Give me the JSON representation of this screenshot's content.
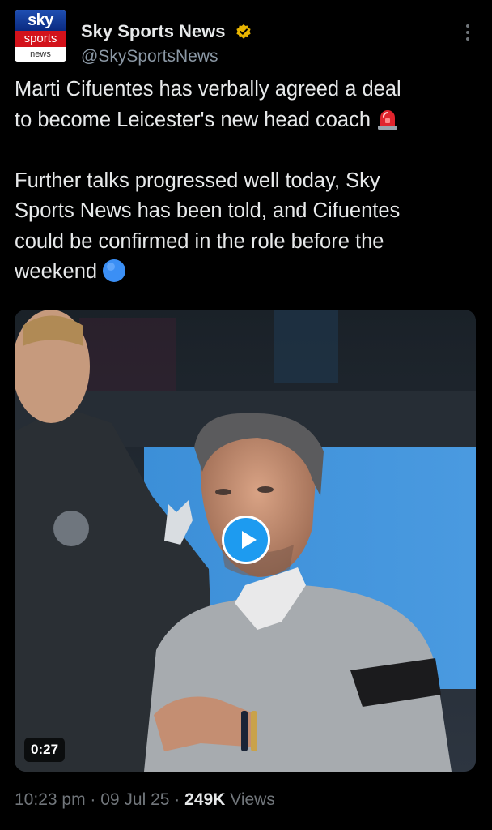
{
  "account": {
    "display_name": "Sky Sports News",
    "handle": "@SkySportsNews",
    "avatar": {
      "line1": "sky",
      "line2": "sports",
      "line3": "news"
    },
    "verified_icon": "gold-verified-badge",
    "verified_color": "#e8b400"
  },
  "tweet": {
    "paragraph1": "Marti Cifuentes has verbally agreed a deal\nto become Leicester's new head coach",
    "paragraph1_emoji": "rotating-light-emoji",
    "paragraph2": "Further talks progressed well today, Sky\nSports News has been told, and Cifuentes\ncould be confirmed in the role before the\nweekend",
    "paragraph2_emoji": "blue-circle-emoji"
  },
  "media": {
    "type": "video",
    "duration": "0:27",
    "play_icon": "play-icon",
    "accent_color": "#1d9bf0"
  },
  "meta": {
    "time": "10:23 pm",
    "separator": " · ",
    "date": "09 Jul 25",
    "views_count": "249K",
    "views_label": "Views"
  }
}
